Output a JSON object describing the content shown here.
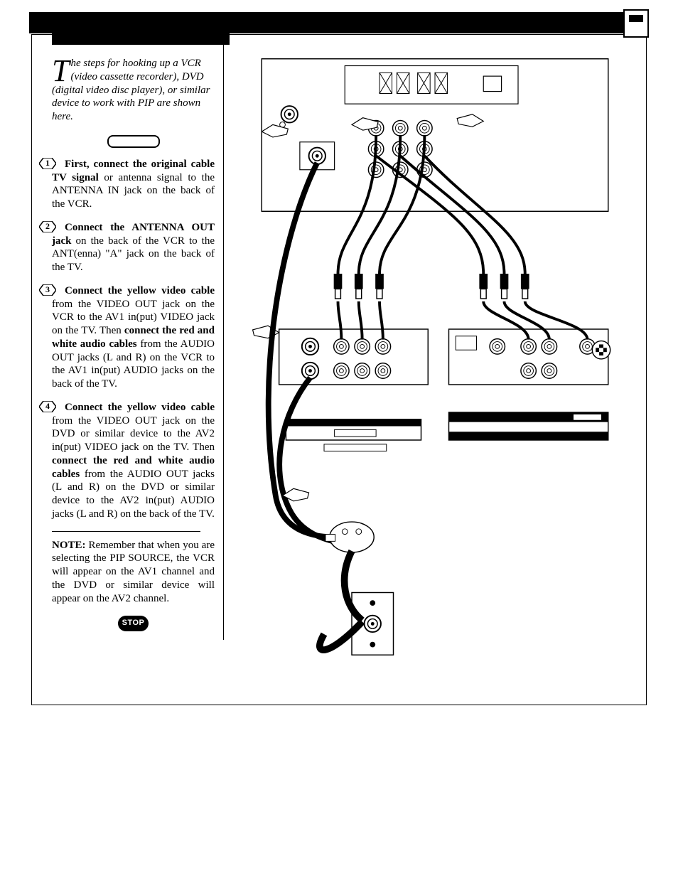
{
  "intro": {
    "dropcap": "T",
    "text": "he steps for hooking up a VCR (video cassette recorder), DVD (digital video disc player), or similar device to work with PIP are shown here."
  },
  "steps": [
    {
      "num": "1",
      "bold1": "First, connect the original cable TV signal",
      "rest1": " or antenna signal to the ANTENNA IN jack on the back of the VCR."
    },
    {
      "num": "2",
      "bold1": "Connect the ANTENNA OUT jack",
      "rest1": " on the back of the VCR to the ANT(enna) \"A\" jack on the back of the TV."
    },
    {
      "num": "3",
      "bold1": "Connect the yellow video cable",
      "rest1": " from the VIDEO OUT jack on the VCR to the AV1 in(put) VIDEO jack on the TV.  Then ",
      "bold2": "connect the red and white audio cables",
      "rest2": " from the AUDIO OUT jacks (L and R) on the VCR to the AV1 in(put) AUDIO jacks on the back of the TV."
    },
    {
      "num": "4",
      "bold1": "Connect the yellow video cable",
      "rest1": " from the VIDEO OUT jack on the DVD or similar device to the AV2 in(put) VIDEO jack on the TV.  Then ",
      "bold2": "connect the red and white audio cables",
      "rest2": " from the AUDIO OUT jacks (L and R) on the DVD or similar device to the AV2 in(put) AUDIO jacks (L and R) on the back of the TV."
    }
  ],
  "note": {
    "label": "NOTE:",
    "text": "  Remember that when you are selecting the PIP SOURCE, the VCR will appear on the AV1 channel and the DVD or similar device will appear on the AV2 channel."
  },
  "stop_label": "STOP"
}
